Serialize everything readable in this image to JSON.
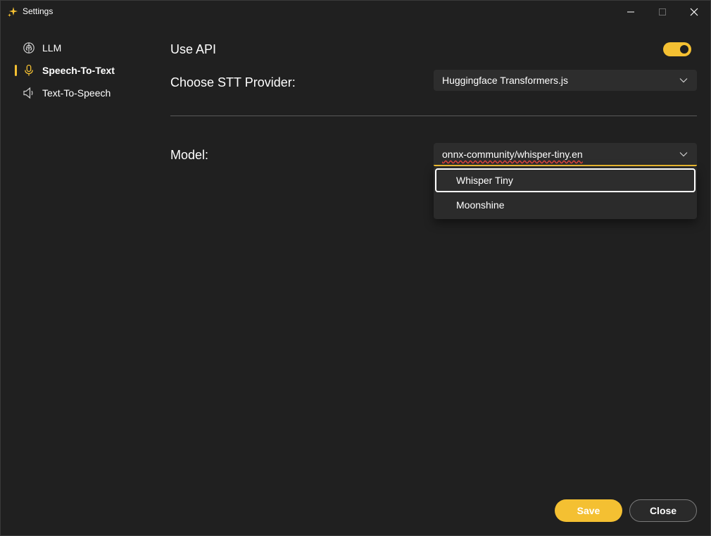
{
  "window": {
    "title": "Settings",
    "icon": "sparkle-icon",
    "controls": [
      "minimize-icon",
      "maximize-icon",
      "close-icon"
    ]
  },
  "sidebar": {
    "items": [
      {
        "label": "LLM",
        "icon": "brain-icon",
        "active": false
      },
      {
        "label": "Speech-To-Text",
        "icon": "microphone-icon",
        "active": true
      },
      {
        "label": "Text-To-Speech",
        "icon": "speaker-icon",
        "active": false
      }
    ]
  },
  "main": {
    "use_api": {
      "label": "Use API",
      "on": true
    },
    "provider": {
      "label": "Choose STT Provider:",
      "value": "Huggingface Transformers.js"
    },
    "model": {
      "label": "Model:",
      "value": "onnx-community/whisper-tiny.en",
      "options": [
        {
          "label": "Whisper Tiny",
          "selected": true
        },
        {
          "label": "Moonshine",
          "selected": false
        }
      ]
    }
  },
  "footer": {
    "save_label": "Save",
    "close_label": "Close"
  },
  "colors": {
    "accent": "#f4c032",
    "background": "#202020",
    "control": "#2d2d2d",
    "spellcheck": "#e8443a"
  }
}
